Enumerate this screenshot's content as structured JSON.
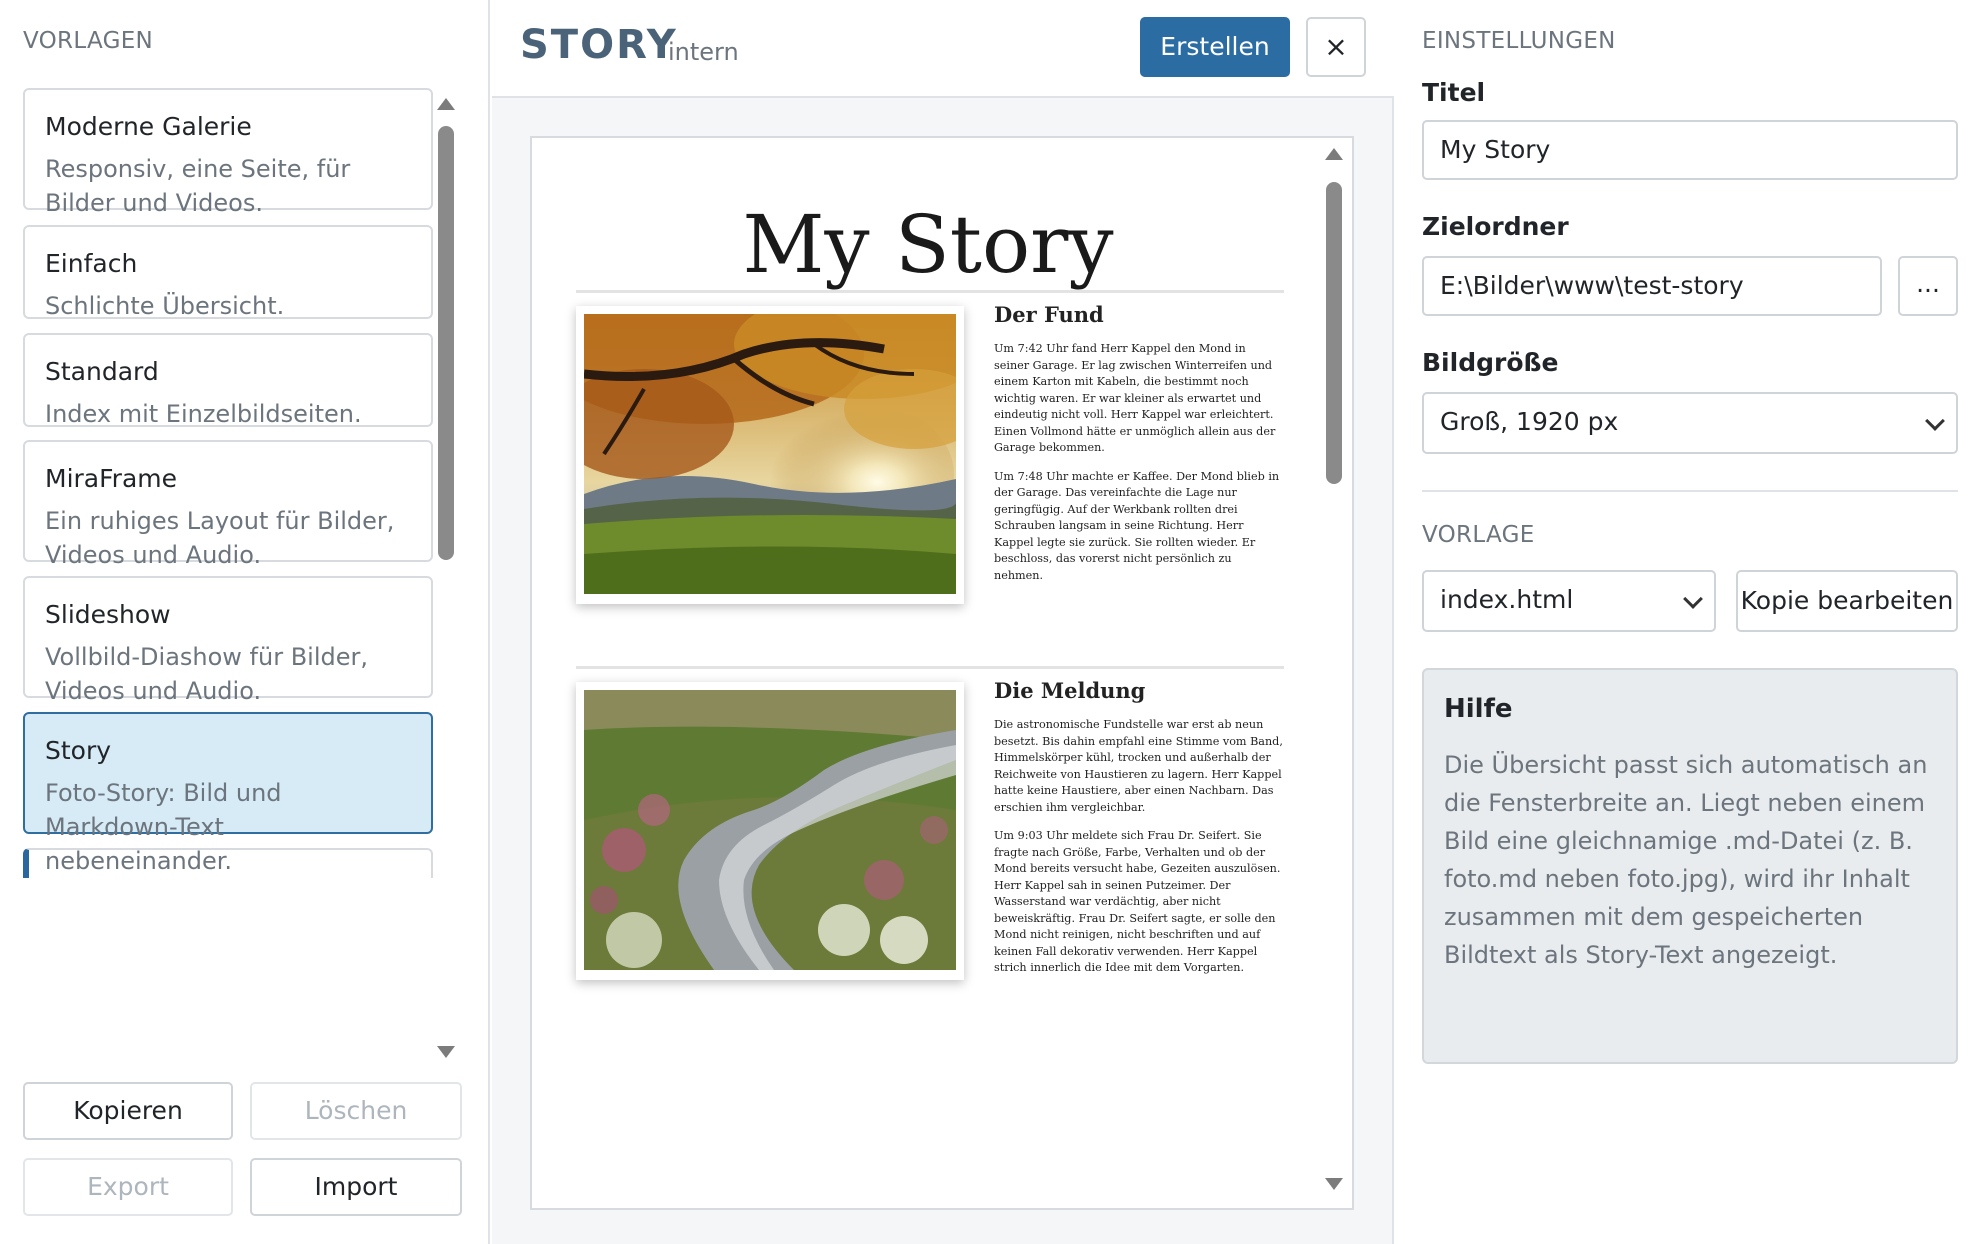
{
  "left": {
    "title": "VORLAGEN",
    "templates": [
      {
        "name": "Moderne Galerie",
        "desc": "Responsiv, eine Seite, für Bilder und Videos."
      },
      {
        "name": "Einfach",
        "desc": "Schlichte Übersicht."
      },
      {
        "name": "Standard",
        "desc": "Index mit Einzelbildseiten."
      },
      {
        "name": "MiraFrame",
        "desc": "Ein ruhiges Layout für Bilder, Videos und Audio."
      },
      {
        "name": "Slideshow",
        "desc": "Vollbild-Diashow für Bilder, Videos und Audio."
      },
      {
        "name": "Story",
        "desc": "Foto-Story: Bild und Markdown-Text nebeneinander.",
        "selected": true
      }
    ],
    "buttons": {
      "copy": "Kopieren",
      "delete": "Löschen",
      "export": "Export",
      "import": "Import"
    }
  },
  "middle": {
    "title": "STORY",
    "subtitle": "intern",
    "create": "Erstellen",
    "close": "×",
    "preview": {
      "title": "My Story",
      "sections": [
        {
          "heading": "Der Fund",
          "paragraphs": [
            "Um 7:42 Uhr fand Herr Kappel den Mond in seiner Garage. Er lag zwischen Winterreifen und einem Karton mit Kabeln, die bestimmt noch wichtig waren. Er war kleiner als erwartet und eindeutig nicht voll. Herr Kappel war erleichtert. Einen Vollmond hätte er unmöglich allein aus der Garage bekommen.",
            "Um 7:48 Uhr machte er Kaffee. Der Mond blieb in der Garage. Das vereinfachte die Lage nur geringfügig. Auf der Werkbank rollten drei Schrauben langsam in seine Richtung. Herr Kappel legte sie zurück. Sie rollten wieder. Er beschloss, das vorerst nicht persönlich zu nehmen."
          ]
        },
        {
          "heading": "Die Meldung",
          "paragraphs": [
            "Die astronomische Fundstelle war erst ab neun besetzt. Bis dahin empfahl eine Stimme vom Band, Himmelskörper kühl, trocken und außerhalb der Reichweite von Haustieren zu lagern. Herr Kappel hatte keine Haustiere, aber einen Nachbarn. Das erschien ihm vergleichbar.",
            "Um 9:03 Uhr meldete sich Frau Dr. Seifert. Sie fragte nach Größe, Farbe, Verhalten und ob der Mond bereits versucht habe, Gezeiten auszulösen. Herr Kappel sah in seinen Putzeimer. Der Wasserstand war verdächtig, aber nicht beweiskräftig. Frau Dr. Seifert sagte, er solle den Mond nicht reinigen, nicht beschriften und auf keinen Fall dekorativ verwenden. Herr Kappel strich innerlich die Idee mit dem Vorgarten."
          ]
        }
      ]
    }
  },
  "right": {
    "title": "EINSTELLUNGEN",
    "fields": {
      "title_label": "Titel",
      "title_value": "My Story",
      "target_label": "Zielordner",
      "target_value": "E:\\Bilder\\www\\test-story",
      "browse": "...",
      "size_label": "Bildgröße",
      "size_value": "Groß, 1920 px"
    },
    "template_section": "VORLAGE",
    "template_value": "index.html",
    "edit_copy": "Kopie bearbeiten",
    "help": {
      "title": "Hilfe",
      "text": "Die Übersicht passt sich automatisch an die Fensterbreite an. Liegt neben einem Bild eine gleichnamige .md-Datei (z. B. foto.md neben foto.jpg), wird ihr Inhalt zusammen mit dem gespeicherten Bildtext als Story-Text angezeigt."
    }
  },
  "colors": {
    "accent": "#2b6ca3",
    "selected_bg": "#d7ebf6"
  },
  "icons": {
    "close": "close-icon",
    "chevron": "chevron-down-icon",
    "scroll_up": "scroll-up-arrow-icon",
    "scroll_down": "scroll-down-arrow-icon"
  }
}
